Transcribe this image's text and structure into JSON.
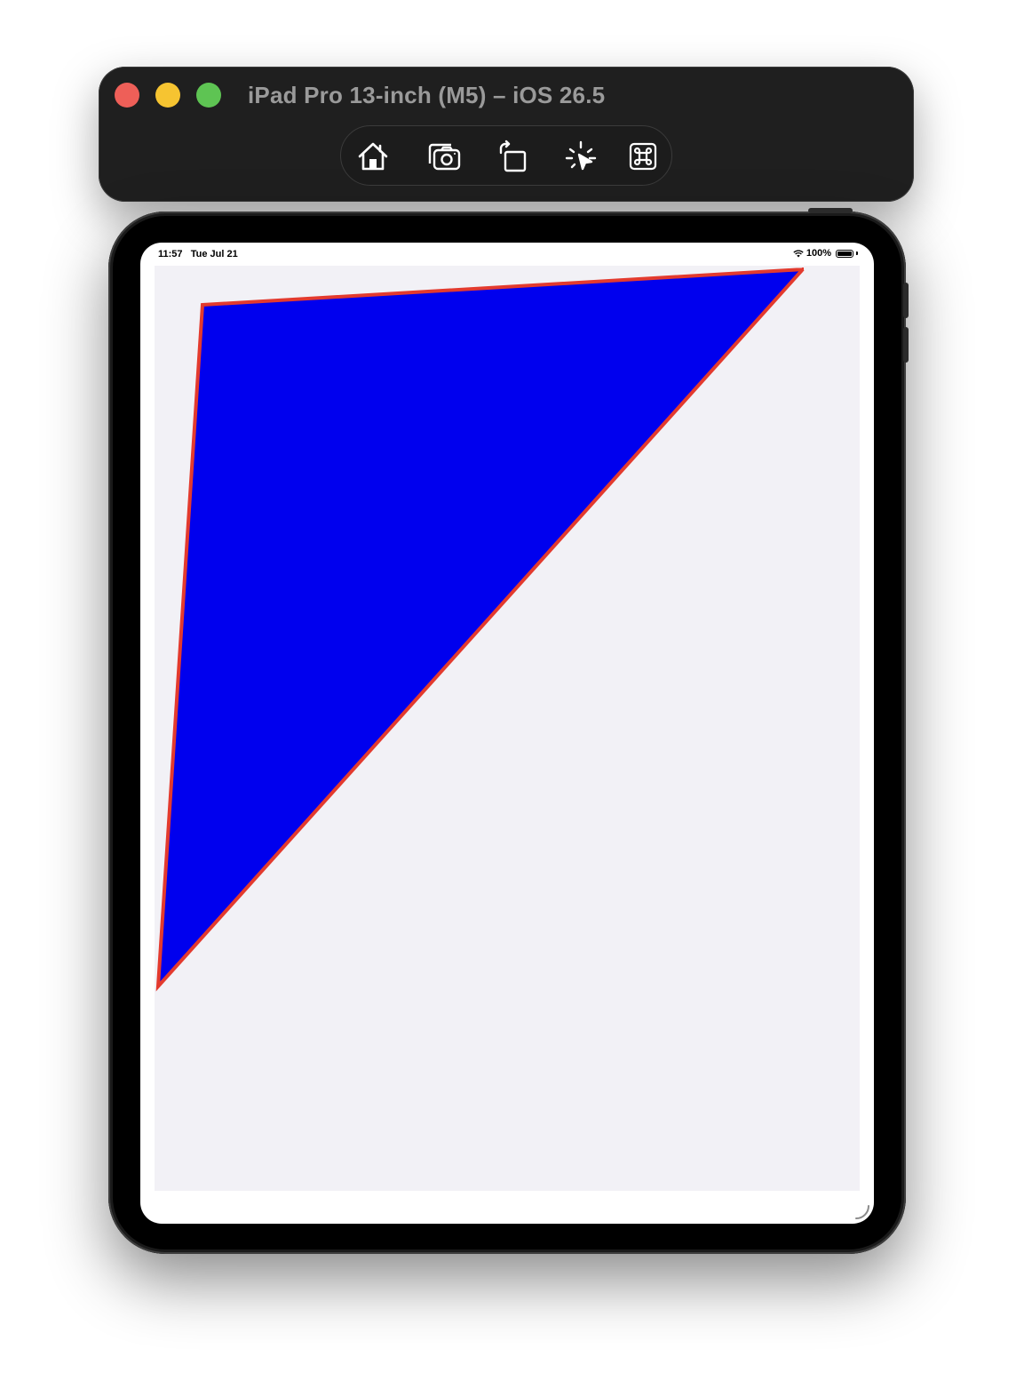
{
  "window": {
    "title": "iPad Pro 13-inch (M5) – iOS 26.5",
    "controls": [
      "close",
      "minimize",
      "zoom"
    ]
  },
  "toolbar": {
    "buttons": [
      {
        "name": "home-button",
        "icon": "house-icon"
      },
      {
        "name": "screenshot-button",
        "icon": "camera-icon"
      },
      {
        "name": "rotate-button",
        "icon": "rotate-icon"
      },
      {
        "name": "touch-button",
        "icon": "tap-icon"
      },
      {
        "name": "keyboard-shortcuts-button",
        "icon": "command-icon"
      }
    ]
  },
  "status_bar": {
    "time": "11:57",
    "date": "Tue Jul 21",
    "battery": "100%",
    "battery_level": 1.0
  },
  "shape": {
    "fill": "#0000ee",
    "stroke": "#e33a2e",
    "background": "#f2f1f6"
  }
}
